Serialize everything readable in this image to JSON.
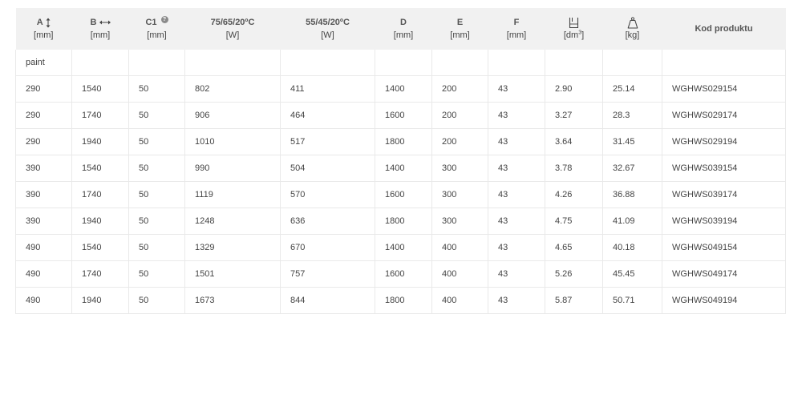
{
  "table": {
    "headers": {
      "a": {
        "label": "A",
        "unit": "[mm]"
      },
      "b": {
        "label": "B",
        "unit": "[mm]"
      },
      "c1": {
        "label": "C1",
        "unit": "[mm]",
        "help": "?"
      },
      "p1": {
        "label": "75/65/20ºC",
        "unit": "[W]"
      },
      "p2": {
        "label": "55/45/20ºC",
        "unit": "[W]"
      },
      "d": {
        "label": "D",
        "unit": "[mm]"
      },
      "e": {
        "label": "E",
        "unit": "[mm]"
      },
      "f": {
        "label": "F",
        "unit": "[mm]"
      },
      "vol": {
        "unit_prefix": "[dm",
        "unit_sup": "3",
        "unit_suffix": "]"
      },
      "wt": {
        "unit": "[kg]"
      },
      "code": {
        "label": "Kod produktu"
      }
    },
    "group_label": "paint",
    "rows": [
      [
        "290",
        "1540",
        "50",
        "802",
        "411",
        "1400",
        "200",
        "43",
        "2.90",
        "25.14",
        "WGHWS029154"
      ],
      [
        "290",
        "1740",
        "50",
        "906",
        "464",
        "1600",
        "200",
        "43",
        "3.27",
        "28.3",
        "WGHWS029174"
      ],
      [
        "290",
        "1940",
        "50",
        "1010",
        "517",
        "1800",
        "200",
        "43",
        "3.64",
        "31.45",
        "WGHWS029194"
      ],
      [
        "390",
        "1540",
        "50",
        "990",
        "504",
        "1400",
        "300",
        "43",
        "3.78",
        "32.67",
        "WGHWS039154"
      ],
      [
        "390",
        "1740",
        "50",
        "1119",
        "570",
        "1600",
        "300",
        "43",
        "4.26",
        "36.88",
        "WGHWS039174"
      ],
      [
        "390",
        "1940",
        "50",
        "1248",
        "636",
        "1800",
        "300",
        "43",
        "4.75",
        "41.09",
        "WGHWS039194"
      ],
      [
        "490",
        "1540",
        "50",
        "1329",
        "670",
        "1400",
        "400",
        "43",
        "4.65",
        "40.18",
        "WGHWS049154"
      ],
      [
        "490",
        "1740",
        "50",
        "1501",
        "757",
        "1600",
        "400",
        "43",
        "5.26",
        "45.45",
        "WGHWS049174"
      ],
      [
        "490",
        "1940",
        "50",
        "1673",
        "844",
        "1800",
        "400",
        "43",
        "5.87",
        "50.71",
        "WGHWS049194"
      ]
    ]
  },
  "icons": {
    "a": "vertical-double-arrow-icon",
    "b": "horizontal-double-arrow-icon",
    "c1": "help-icon",
    "vol": "water-volume-icon",
    "wt": "weight-icon"
  },
  "colors": {
    "header_bg": "#f1f1f1",
    "border": "#e9e9e9",
    "text": "#444444"
  }
}
